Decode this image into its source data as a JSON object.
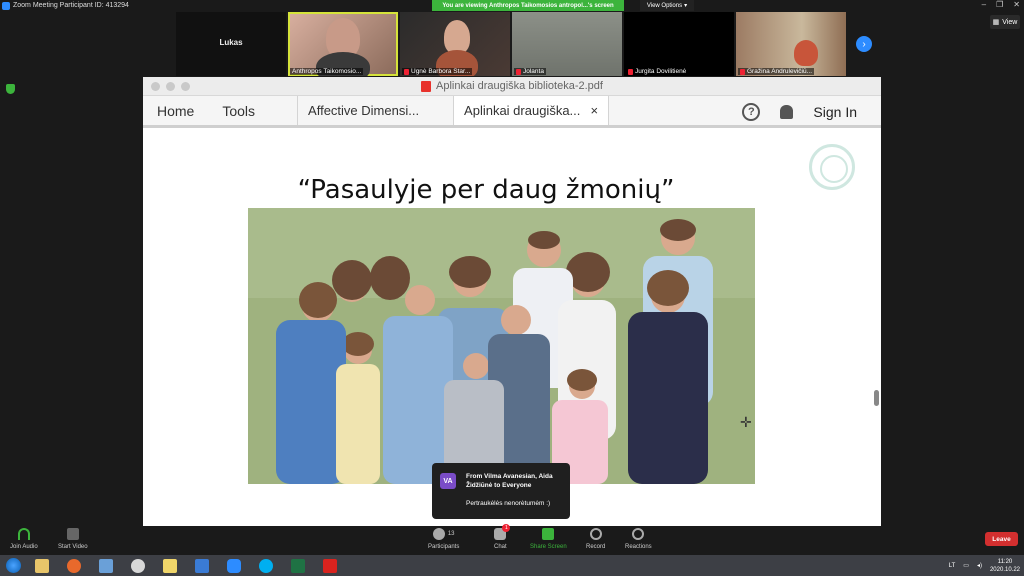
{
  "window": {
    "title": "Zoom Meeting Participant ID: 413294"
  },
  "banner": {
    "viewing_text": "You are viewing Anthropos Taikomosios antropol...'s screen",
    "view_options_label": "View Options"
  },
  "view_button": {
    "label": "View"
  },
  "participants": [
    {
      "name": "Lukas"
    },
    {
      "name": "Anthropos Taikomosio..."
    },
    {
      "name": "Ugnė Barbora Star..."
    },
    {
      "name": "Jolanta"
    },
    {
      "name": "Jurgita Dovilitienė"
    },
    {
      "name": "Gražina Andrulevičiū..."
    }
  ],
  "pdf": {
    "window_title": "Aplinkai draugiška biblioteka-2.pdf",
    "toolbar": {
      "home": "Home",
      "tools": "Tools",
      "help": "?",
      "sign_in": "Sign In"
    },
    "tabs": [
      {
        "label": "Affective Dimensi..."
      },
      {
        "label": "Aplinkai draugiška...",
        "close": "×"
      }
    ],
    "slide_title": "“Pasaulyje per daug žmonių”"
  },
  "chat_popup": {
    "avatar": "VA",
    "from": "From Vilma Avanesian, Aida Židžiūnė to Everyone",
    "message": "Pertraukėlės nenorėtumėm :)"
  },
  "controls": {
    "join_audio": "Join Audio",
    "start_video": "Start Video",
    "participants": "Participants",
    "participants_count": "13",
    "chat": "Chat",
    "chat_badge": "1",
    "share_screen": "Share Screen",
    "record": "Record",
    "reactions": "Reactions",
    "leave": "Leave"
  },
  "taskbar": {
    "lang": "LT",
    "time": "11:20",
    "date": "2020.10.22"
  },
  "icons": [
    "zoom-icon",
    "shield-icon",
    "pdf-icon",
    "help-icon",
    "bell-icon",
    "close-icon",
    "chat-icon",
    "arrow-right-icon",
    "windows-start-icon"
  ]
}
